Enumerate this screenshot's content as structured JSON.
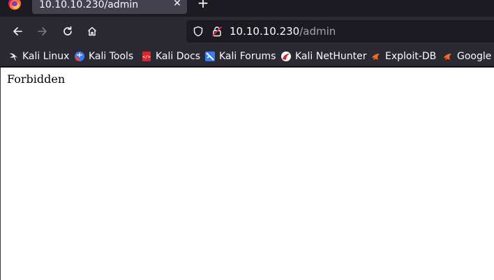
{
  "tab": {
    "title": "10.10.10.230/admin",
    "close_icon": "close-icon"
  },
  "toolbar": {
    "back_icon": "arrow-left-icon",
    "forward_icon": "arrow-right-icon",
    "reload_icon": "reload-icon",
    "home_icon": "home-icon"
  },
  "urlbar": {
    "host": "10.10.10.230",
    "path": "/admin",
    "tracking_icon": "shield-icon",
    "security_icon": "lock-warning-icon"
  },
  "bookmarks": [
    {
      "label": "Kali Linux",
      "icon": "kali-dragon-icon"
    },
    {
      "label": "Kali Tools",
      "icon": "kali-tools-icon"
    },
    {
      "label": "Kali Docs",
      "icon": "kali-docs-icon"
    },
    {
      "label": "Kali Forums",
      "icon": "kali-forums-icon"
    },
    {
      "label": "Kali NetHunter",
      "icon": "nethunter-icon"
    },
    {
      "label": "Exploit-DB",
      "icon": "exploit-db-icon"
    },
    {
      "label": "Google H",
      "icon": "ghdb-icon"
    }
  ],
  "page": {
    "body_text": "Forbidden"
  },
  "colors": {
    "chrome_dark": "#1c1b22",
    "toolbar": "#2b2a33",
    "active_tab": "#42414d",
    "text_light": "#fbfbfe",
    "text_dim": "#a3a3ad",
    "content_bg": "#ffffff"
  }
}
